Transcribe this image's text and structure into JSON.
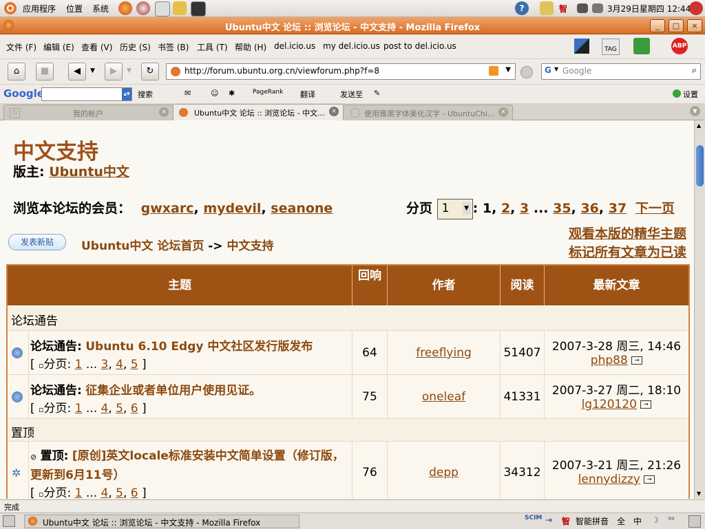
{
  "top_panel": {
    "menus": [
      "应用程序",
      "位置",
      "系统"
    ],
    "clock": "3月29日星期四 12:44",
    "ime_label": "智"
  },
  "window": {
    "title": "Ubuntu中文 论坛 :: 浏览论坛 - 中文支持 - Mozilla Firefox"
  },
  "menubar": {
    "items": [
      "文件 (F)",
      "编辑 (E)",
      "查看 (V)",
      "历史 (S)",
      "书签 (B)",
      "工具 (T)",
      "帮助 (H)",
      "del.icio.us",
      "my del.icio.us",
      "post to del.icio.us"
    ],
    "tag_label": "TAG",
    "abp_label": "ABP"
  },
  "navbar": {
    "url": "http://forum.ubuntu.org.cn/viewforum.php?f=8",
    "search_placeholder": "Google"
  },
  "google_toolbar": {
    "logo": "Google",
    "search_btn": "搜索",
    "pagerank": "PageRank",
    "translate": "翻译",
    "sendto": "发送至",
    "settings": "设置"
  },
  "tabs": [
    {
      "label": "我的帐户",
      "active": false
    },
    {
      "label": "Ubuntu中文 论坛 :: 浏览论坛 - 中文...",
      "active": true
    },
    {
      "label": "使用雅黑字体美化汉字 - UbuntuChi...",
      "active": false
    }
  ],
  "page": {
    "forum_title": "中文支持",
    "moderator_label": "版主:",
    "moderator": "Ubuntu中文",
    "members_label": "浏览本论坛的会员：",
    "members": [
      "gwxarc",
      "mydevil",
      "seanone"
    ],
    "pager_label": "分页",
    "pager_select": "1",
    "pager_current": "1",
    "pager_links": [
      "2",
      "3",
      "35",
      "36",
      "37"
    ],
    "pager_ellipsis": "...",
    "pager_next": "下一页",
    "new_topic_btn": "发表新贴",
    "breadcrumb_home": "Ubuntu中文 论坛首页",
    "breadcrumb_sep": "->",
    "breadcrumb_current": "中文支持",
    "link_featured": "观看本版的精华主题",
    "link_markread": "标记所有文章为已读"
  },
  "table": {
    "headers": [
      "主题",
      "回响",
      "作者",
      "阅读",
      "最新文章"
    ],
    "sections": [
      {
        "name": "论坛通告"
      },
      {
        "name": "置顶"
      }
    ],
    "rows": [
      {
        "prefix": "论坛通告:",
        "title": "Ubuntu 6.10 Edgy 中文社区发行版发布",
        "pages_label": "分页:",
        "pages": [
          "1",
          "3",
          "4",
          "5"
        ],
        "replies": "64",
        "author": "freeflying",
        "views": "51407",
        "last_time": "2007-3-28 周三, 14:46",
        "last_user": "php88"
      },
      {
        "prefix": "论坛通告:",
        "title": "征集企业或者单位用户使用见证。",
        "pages_label": "分页:",
        "pages": [
          "1",
          "4",
          "5",
          "6"
        ],
        "replies": "75",
        "author": "oneleaf",
        "views": "41331",
        "last_time": "2007-3-27 周二, 18:10",
        "last_user": "lg120120"
      },
      {
        "prefix": "置顶:",
        "title": "[原创]英文locale标准安装中文简单设置（修订版，更新到6月11号）",
        "pages_label": "分页:",
        "pages": [
          "1",
          "4",
          "5",
          "6"
        ],
        "replies": "76",
        "author": "depp",
        "views": "34312",
        "last_time": "2007-3-21 周三, 21:26",
        "last_user": "lennydizzy"
      }
    ]
  },
  "statusbar": {
    "text": "完成"
  },
  "taskbar": {
    "window_item": "Ubuntu中文 论坛 :: 浏览论坛 - 中文支持 - Mozilla Firefox",
    "ime_items": [
      "智能拼音",
      "全",
      "中"
    ]
  },
  "colors": {
    "accent": "#9e5314",
    "link": "#8c4a10",
    "titlebar": "#d86d22"
  }
}
